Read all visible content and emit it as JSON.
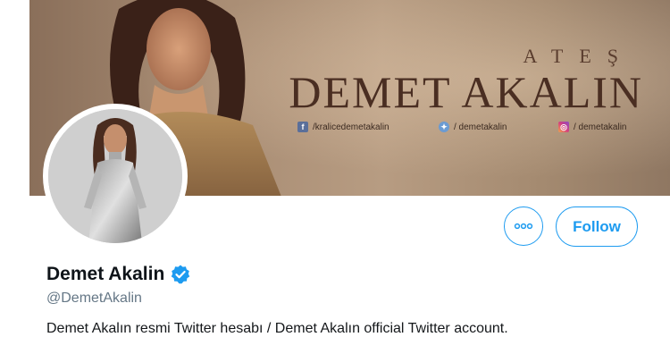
{
  "banner": {
    "subtitle": "ATEŞ",
    "title": "DEMET AKALIN",
    "socials": [
      {
        "icon": "facebook-icon",
        "text": "/kralicedemetakalin"
      },
      {
        "icon": "twitter-bird-icon",
        "text": "/ demetakalin"
      },
      {
        "icon": "instagram-icon",
        "text": "/ demetakalin"
      }
    ]
  },
  "profile": {
    "display_name": "Demet Akalin",
    "handle": "@DemetAkalin",
    "bio": "Demet Akalın resmi Twitter hesabı / Demet Akalın official Twitter account.",
    "verified_icon": "verified-badge-icon"
  },
  "actions": {
    "more_icon": "more-options-icon",
    "follow_label": "Follow"
  },
  "colors": {
    "accent": "#1d9bf0",
    "verified": "#1d9bf0",
    "text_primary": "#0f1419",
    "text_secondary": "#657786"
  }
}
